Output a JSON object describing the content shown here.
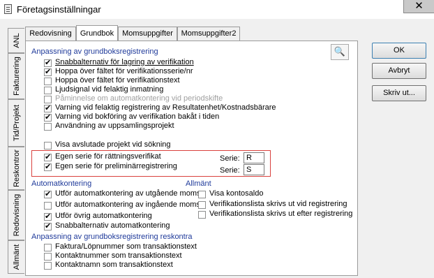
{
  "window": {
    "title": "Företagsinställningar",
    "close_glyph": "✕",
    "icon": "document-icon"
  },
  "vertical_tabs": [
    "ANL",
    "Fakturering",
    "Tid/Projekt",
    "Reskontror",
    "Redovisning",
    "Allmänt"
  ],
  "horizontal_tabs": [
    {
      "label": "Redovisning",
      "active": false
    },
    {
      "label": "Grundbok",
      "active": true
    },
    {
      "label": "Momsuppgifter",
      "active": false
    },
    {
      "label": "Momsuppgifter2",
      "active": false
    }
  ],
  "sections": {
    "grundbok_title": "Anpassning av grundboksregistrering",
    "auto_title": "Automatkontering",
    "allmant_title": "Allmänt",
    "reskontra_title": "Anpassning av grundboksregistrering reskontra"
  },
  "grundbok_options": [
    {
      "label": "Snabbalternativ för lagring av verifikation",
      "checked": true
    },
    {
      "label": "Hoppa över fältet för verifikationsserie/nr",
      "checked": true
    },
    {
      "label": "Hoppa över fältet för verifikationstext",
      "checked": false
    },
    {
      "label": "Ljudsignal vid felaktig inmatning",
      "checked": false
    },
    {
      "label": "Påminnelse om automatkontering vid periodskifte",
      "checked": false
    },
    {
      "label": "Varning vid felaktig registrering av Resultatenhet/Kostnadsbärare",
      "checked": true
    },
    {
      "label": "Varning vid bokföring av verifikation bakåt i tiden",
      "checked": true
    },
    {
      "label": "Användning av uppsamlingsprojekt",
      "checked": false
    },
    {
      "label": "Visa avslutade projekt vid sökning",
      "checked": false
    },
    {
      "label": "Egen serie för rättningsverifikat",
      "checked": true
    },
    {
      "label": "Egen serie för preliminärregistrering",
      "checked": true
    }
  ],
  "serie": {
    "label": "Serie:",
    "rattning_value": "R",
    "prelim_value": "S"
  },
  "auto_options": [
    {
      "label": "Utför automatkontering av utgående moms",
      "checked": true
    },
    {
      "label": "Utför automatkontering av ingående moms",
      "checked": false
    },
    {
      "label": "Utför övrig automatkontering",
      "checked": true
    },
    {
      "label": "Snabbalternativ automatkontering",
      "checked": true
    }
  ],
  "allmant_options": [
    {
      "label": "Visa kontosaldo",
      "checked": false
    },
    {
      "label": "Verifikationslista skrivs ut vid registrering",
      "checked": false
    },
    {
      "label": "Verifikationslista skrivs ut efter registrering",
      "checked": false
    }
  ],
  "reskontra_options": [
    {
      "label": "Faktura/Löpnummer som transaktionstext",
      "checked": false
    },
    {
      "label": "Kontaktnummer som transaktionstext",
      "checked": false
    },
    {
      "label": "Kontaktnamn som transaktionstext",
      "checked": false
    }
  ],
  "buttons": {
    "ok": "OK",
    "cancel": "Avbryt",
    "print": "Skriv ut..."
  },
  "search_icon": "binoculars-icon",
  "search_glyph": "🔍"
}
